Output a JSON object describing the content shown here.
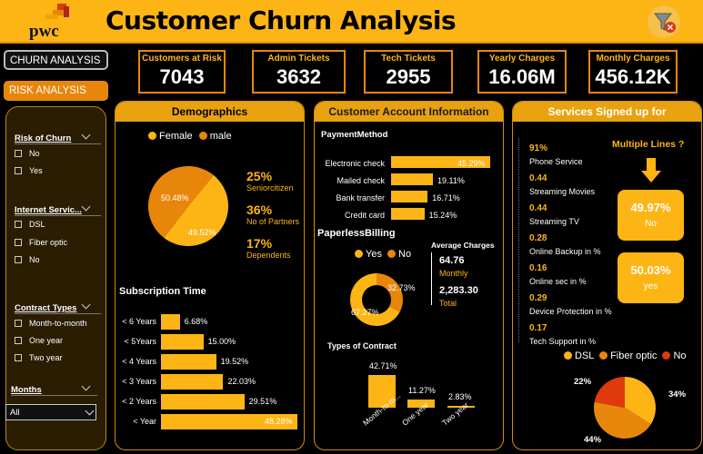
{
  "header": {
    "logo_text": "pwc",
    "title": "Customer Churn Analysis",
    "filter_icon": "funnel-clear-icon"
  },
  "nav": {
    "churn_label": "CHURN ANALYSIS",
    "risk_label": "RISK ANALYSIS"
  },
  "filters": {
    "risk": {
      "label": "Risk of Churn",
      "options": [
        "No",
        "Yes"
      ]
    },
    "internet": {
      "label": "Internet Servic...",
      "options": [
        "DSL",
        "Fiber optic",
        "No"
      ]
    },
    "contract": {
      "label": "Contract Types",
      "options": [
        "Month-to-month",
        "One year",
        "Two year"
      ]
    },
    "months": {
      "label": "Months",
      "selected": "All"
    }
  },
  "kpis": [
    {
      "label": "Customers at Risk",
      "value": "7043"
    },
    {
      "label": "Admin Tickets",
      "value": "3632"
    },
    {
      "label": "Tech Tickets",
      "value": "2955"
    },
    {
      "label": "Yearly Charges",
      "value": "16.06M"
    },
    {
      "label": "Monthly Charges",
      "value": "456.12K"
    }
  ],
  "demographics": {
    "title": "Demographics",
    "legend": [
      "Female",
      "male"
    ],
    "pie": {
      "female_label": "49.52%",
      "male_label": "50.48%",
      "female": 49.52,
      "male": 50.48
    },
    "stats": [
      {
        "pct": "25%",
        "label": "Seniorcitizen"
      },
      {
        "pct": "36%",
        "label": "No of Partners"
      },
      {
        "pct": "17%",
        "label": "Dependents"
      }
    ],
    "subscription_title": "Subscription Time",
    "subscription": [
      {
        "cat": "< 6 Years",
        "label": "6.68%",
        "value": 6.68
      },
      {
        "cat": "< 5Years",
        "label": "15.00%",
        "value": 15.0
      },
      {
        "cat": "< 4 Years",
        "label": "19.52%",
        "value": 19.52
      },
      {
        "cat": "< 3 Years",
        "label": "22.03%",
        "value": 22.03
      },
      {
        "cat": "< 2 Years",
        "label": "29.51%",
        "value": 29.51
      },
      {
        "cat": "< Year",
        "label": "48.28%",
        "value": 48.28
      }
    ]
  },
  "account": {
    "title": "Customer Account Information",
    "payment_title": "PaymentMethod",
    "payment": [
      {
        "cat": "Electronic check",
        "label": "45.29%",
        "value": 45.29
      },
      {
        "cat": "Mailed check",
        "label": "19.11%",
        "value": 19.11
      },
      {
        "cat": "Bank transfer",
        "label": "16.71%",
        "value": 16.71
      },
      {
        "cat": "Credit card",
        "label": "15.24%",
        "value": 15.24
      }
    ],
    "paperless_title": "PaperlessBilling",
    "paperless_legend": [
      "Yes",
      "No"
    ],
    "paperless": {
      "yes": 67.27,
      "no": 32.73,
      "yes_label": "67.27%",
      "no_label": "32.73%"
    },
    "avg_title": "Average Charges",
    "monthly_value": "64.76",
    "monthly_label": "Monthly",
    "total_value": "2,283.30",
    "total_label": "Total",
    "contract_title": "Types of Contract",
    "contracts": [
      {
        "cat": "Month-to-m...",
        "label": "42.71%",
        "value": 42.71
      },
      {
        "cat": "One year",
        "label": "11.27%",
        "value": 11.27
      },
      {
        "cat": "Two year",
        "label": "2.83%",
        "value": 2.83
      }
    ]
  },
  "services": {
    "title": "Services Signed up for",
    "items": [
      {
        "pct": "91%",
        "label": "Phone Service"
      },
      {
        "pct": "0.44",
        "label": "Streaming Movies"
      },
      {
        "pct": "0.44",
        "label": "Streaming TV"
      },
      {
        "pct": "0.28",
        "label": "Online Backup in %"
      },
      {
        "pct": "0.16",
        "label": "Online sec in %"
      },
      {
        "pct": "0.29",
        "label": "Device Protection in %"
      },
      {
        "pct": "0.17",
        "label": "Tech Support in %"
      }
    ],
    "multiple_lines_title": "Multiple Lines ?",
    "no_value": "49.97%",
    "no_label": "No",
    "yes_value": "50.03%",
    "yes_label": "yes",
    "internet_legend": [
      "DSL",
      "Fiber optic",
      "No"
    ],
    "internet": [
      {
        "name": "DSL",
        "label": "34%",
        "value": 34
      },
      {
        "name": "Fiber optic",
        "label": "44%",
        "value": 44
      },
      {
        "name": "No",
        "label": "22%",
        "value": 22
      }
    ]
  },
  "colors": {
    "accent": "#fdb515",
    "orange": "#e8860c",
    "dark_orange": "#d9730d",
    "red": "#e03a0c"
  }
}
